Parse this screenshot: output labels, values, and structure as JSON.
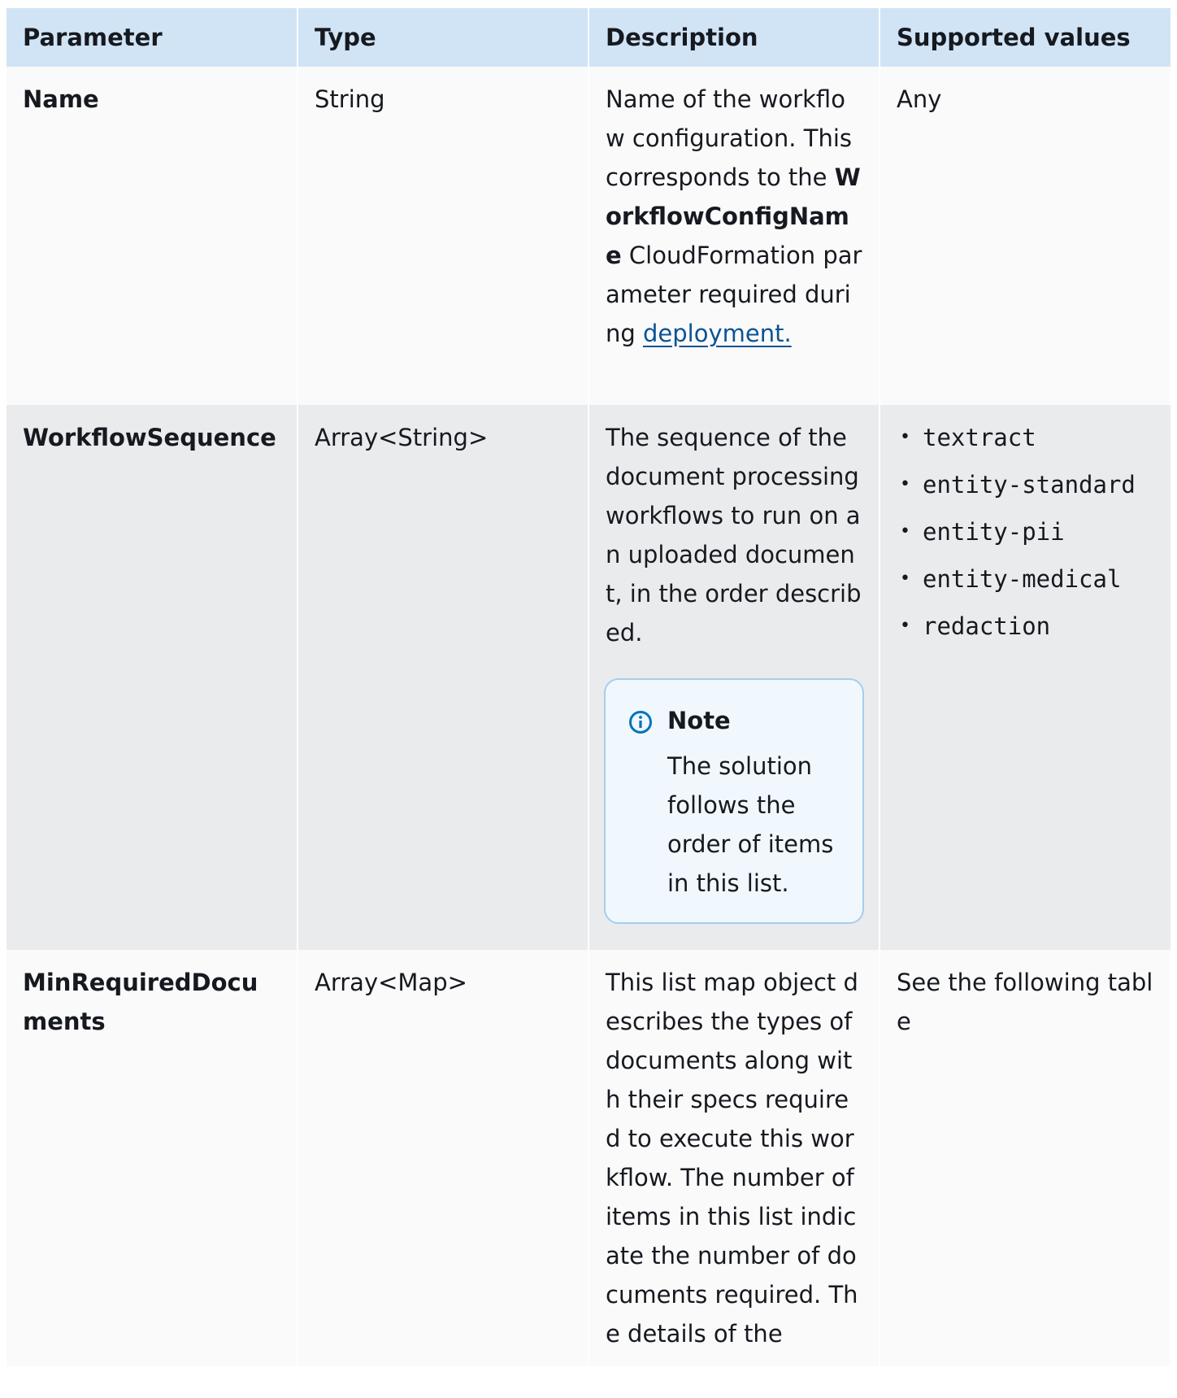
{
  "headers": {
    "parameter": "Parameter",
    "type": "Type",
    "description": "Description",
    "supported_values": "Supported values"
  },
  "rows": [
    {
      "parameter": "Name",
      "type": "String",
      "description": {
        "part1": "Name of the workflow configuration. This corresponds to the ",
        "bold": "WorkflowConfigName",
        "part2": " CloudFormation parameter required during ",
        "link": "deployment."
      },
      "supported": "Any"
    },
    {
      "parameter": "WorkflowSequence",
      "type": "Array<String>",
      "description": {
        "text": "The sequence of the document processing workflows to run on an uploaded document, in the order described."
      },
      "note": {
        "icon": "info-icon",
        "title": "Note",
        "body": "The solution follows the order of items in this list."
      },
      "supported_list": [
        "textract",
        "entity-standard",
        "entity-pii",
        "entity-medical",
        "redaction"
      ]
    },
    {
      "parameter": "MinRequiredDocuments",
      "type": "Array<Map>",
      "description": {
        "text": "This list map object describes the types of documents along with their specs required to execute this workflow. The number of items in this list indicate the number of documents required. The details of the"
      },
      "supported": "See the following table"
    }
  ],
  "colors": {
    "header_bg": "#d1e4f6",
    "row_light_bg": "#fafafa",
    "row_dark_bg": "#eaebed",
    "link": "#0b5394",
    "note_border": "#a6cdee",
    "note_bg": "#f0f8fe",
    "info_icon": "#0073bb"
  }
}
